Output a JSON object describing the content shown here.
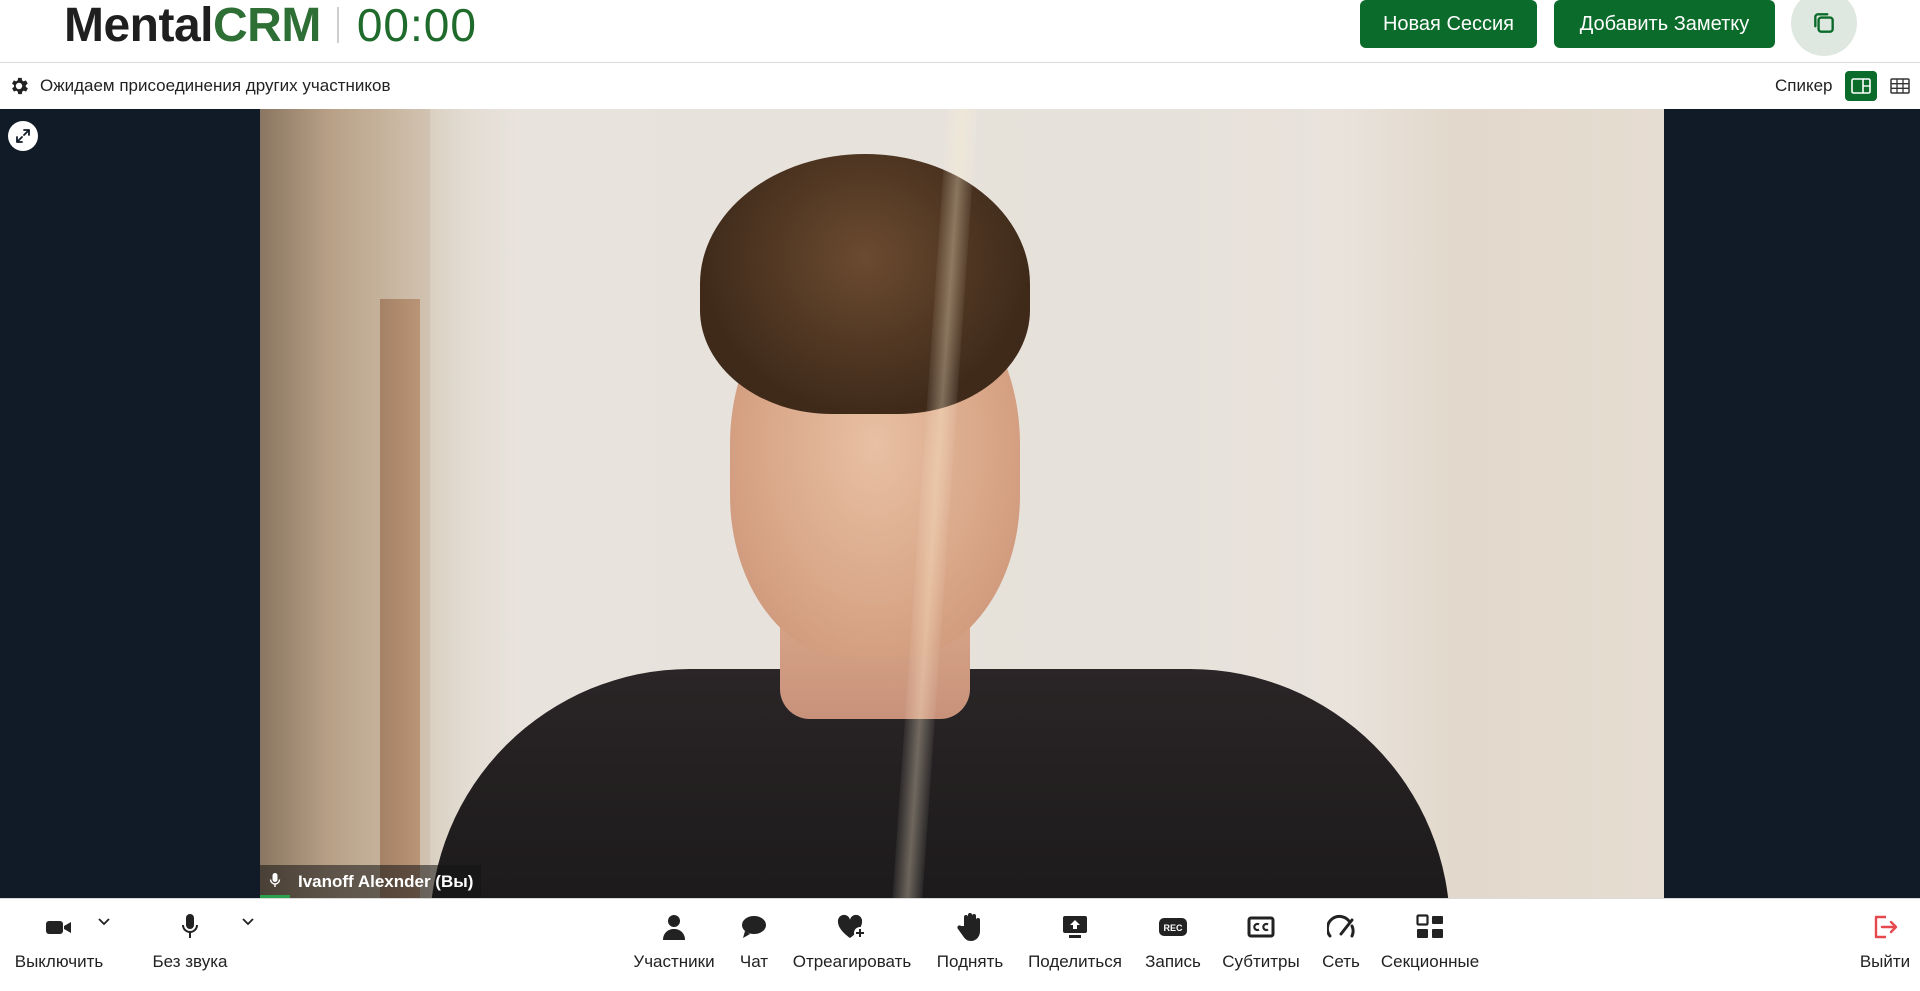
{
  "header": {
    "brand_part1": "Mental",
    "brand_part2": "CRM",
    "timer": "00:00",
    "new_session_label": "Новая Сессия",
    "add_note_label": "Добавить Заметку"
  },
  "statusbar": {
    "status_text": "Ожидаем присоединения других участников",
    "speaker_label": "Спикер"
  },
  "video": {
    "participant_name": "Ivanoff Alexnder (Вы)"
  },
  "toolbar": {
    "camera_label": "Выключить",
    "mic_label": "Без звука",
    "participants_label": "Участники",
    "chat_label": "Чат",
    "react_label": "Отреагировать",
    "raise_label": "Поднять",
    "share_label": "Поделиться",
    "record_label": "Запись",
    "record_badge": "REC",
    "subtitles_label": "Субтитры",
    "network_label": "Сеть",
    "breakout_label": "Секционные",
    "leave_label": "Выйти"
  },
  "colors": {
    "brand_green": "#0a6b2a",
    "stage_bg": "#111b27",
    "leave_red": "#e5484d"
  }
}
